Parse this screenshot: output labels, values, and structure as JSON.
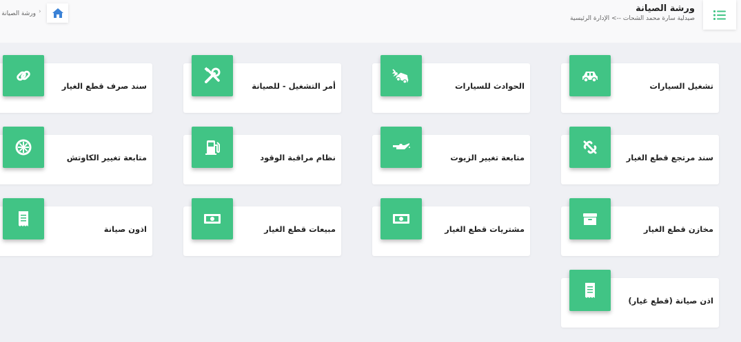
{
  "header": {
    "title": "ورشة الصيانة",
    "subtitle": "صيدلية سارة محمد الشحات --> الإدارة الرئيسية",
    "menu_icon": "list-icon",
    "home_icon": "home-icon",
    "breadcrumb_separator": "›",
    "breadcrumb_current": "ورشة الصيانة"
  },
  "accent_color": "#41c485",
  "cards": [
    {
      "label": "تشغيل السيارات",
      "icon": "car-icon"
    },
    {
      "label": "الحوادث للسيارات",
      "icon": "car-crash-icon"
    },
    {
      "label": "أمر التشغيل - للصيانة",
      "icon": "tools-icon"
    },
    {
      "label": "سند صرف قطع الغيار",
      "icon": "link-icon"
    },
    {
      "label": "سند مرتجع قطع الغيار",
      "icon": "unlink-icon"
    },
    {
      "label": "متابعة تغيير الزيوت",
      "icon": "oil-can-icon"
    },
    {
      "label": "نظام مراقبة الوقود",
      "icon": "gas-pump-icon"
    },
    {
      "label": "متابعة تغيير الكاوتش",
      "icon": "tire-icon"
    },
    {
      "label": "مخازن قطع الغيار",
      "icon": "archive-box-icon"
    },
    {
      "label": "مشتريات قطع الغيار",
      "icon": "money-bill-icon"
    },
    {
      "label": "مبيعات قطع الغيار",
      "icon": "money-bill-icon"
    },
    {
      "label": "اذون صيانة",
      "icon": "receipt-icon"
    },
    {
      "label": "اذن صيانة (قطع غيار)",
      "icon": "receipt-icon"
    }
  ]
}
